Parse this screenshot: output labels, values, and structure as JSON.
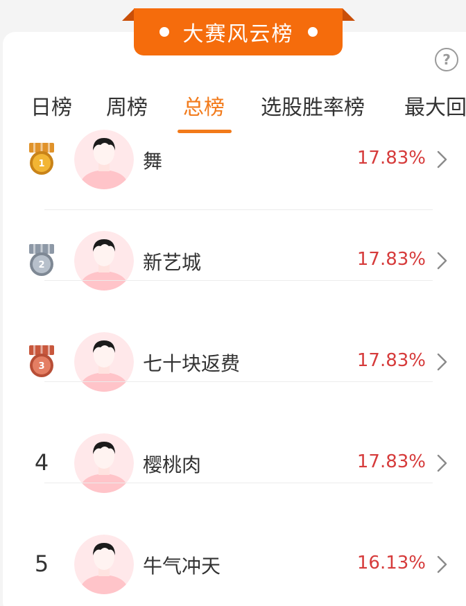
{
  "header": {
    "title": "大赛风云榜"
  },
  "help_label": "?",
  "tabs": [
    {
      "label": "日榜",
      "active": false
    },
    {
      "label": "周榜",
      "active": false
    },
    {
      "label": "总榜",
      "active": true
    },
    {
      "label": "选股胜率榜",
      "active": false
    },
    {
      "label": "最大回",
      "active": false
    }
  ],
  "rankings": [
    {
      "rank": "1",
      "medal": "gold",
      "name": "舞",
      "value": "17.83%"
    },
    {
      "rank": "2",
      "medal": "silver",
      "name": "新艺城",
      "value": "17.83%"
    },
    {
      "rank": "3",
      "medal": "bronze",
      "name": "七十块返费",
      "value": "17.83%"
    },
    {
      "rank": "4",
      "medal": null,
      "name": "樱桃肉",
      "value": "17.83%"
    },
    {
      "rank": "5",
      "medal": null,
      "name": "牛气冲天",
      "value": "16.13%"
    }
  ],
  "colors": {
    "accent": "#f27a1a",
    "ribbon": "#f56c0c",
    "percent": "#d63b3b",
    "gold": "#e8a21f",
    "silver": "#9aa4b0",
    "bronze": "#d76b4f"
  },
  "icons": {
    "medal": "medal-icon",
    "avatar": "default-avatar-icon",
    "chevron": "chevron-right-icon",
    "help": "question-circle-icon"
  }
}
